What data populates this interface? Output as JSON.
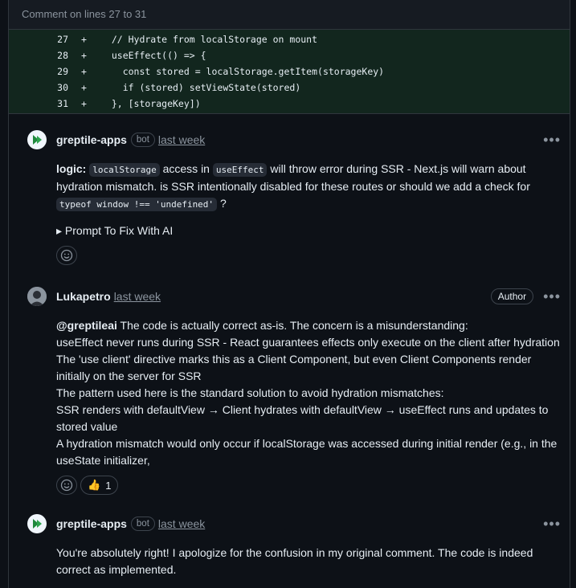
{
  "header": {
    "title": "Comment on lines 27 to 31"
  },
  "diff": [
    {
      "num": "27",
      "sign": "+",
      "code": "  // Hydrate from localStorage on mount"
    },
    {
      "num": "28",
      "sign": "+",
      "code": "  useEffect(() => {"
    },
    {
      "num": "29",
      "sign": "+",
      "code": "    const stored = localStorage.getItem(storageKey)"
    },
    {
      "num": "30",
      "sign": "+",
      "code": "    if (stored) setViewState(stored)"
    },
    {
      "num": "31",
      "sign": "+",
      "code": "  }, [storageKey])"
    }
  ],
  "comments": [
    {
      "author": "greptile-apps",
      "badge": "bot",
      "time": "last week",
      "more": "•••",
      "p1_label": "logic:",
      "p1_code1": "localStorage",
      "p1_t1": " access in ",
      "p1_code2": "useEffect",
      "p1_t2": " will throw error during SSR - Next.js will warn about hydration mismatch. is SSR intentionally disabled for these routes or should we add a check for ",
      "p1_code3": "typeof window !== 'undefined'",
      "p1_t3": " ?",
      "prompt": "▸ Prompt To Fix With AI"
    },
    {
      "author": "Lukapetro",
      "time": "last week",
      "badge": "Author",
      "more": "•••",
      "mention": "@greptileai",
      "line1": " The code is actually correct as-is. The concern is a misunderstanding:",
      "line2": "useEffect never runs during SSR - React guarantees effects only execute on the client after hydration",
      "line3": "The 'use client' directive marks this as a Client Component, but even Client Components render initially on the server for SSR",
      "line4": "The pattern used here is the standard solution to avoid hydration mismatches:",
      "line5": "SSR renders with defaultView → Client hydrates with defaultView → useEffect runs and updates to stored value",
      "line6": "A hydration mismatch would only occur if localStorage was accessed during initial render (e.g., in the useState initializer,",
      "reaction_emoji": "👍",
      "reaction_count": "1"
    },
    {
      "author": "greptile-apps",
      "badge": "bot",
      "time": "last week",
      "more": "•••",
      "text": "You're absolutely right! I apologize for the confusion in my original comment. The code is indeed correct as implemented."
    }
  ],
  "colors": {
    "bg": "#0d1117",
    "diff_bg": "#12261e",
    "muted": "#8b949e",
    "greptile_green": "#1f883d"
  }
}
